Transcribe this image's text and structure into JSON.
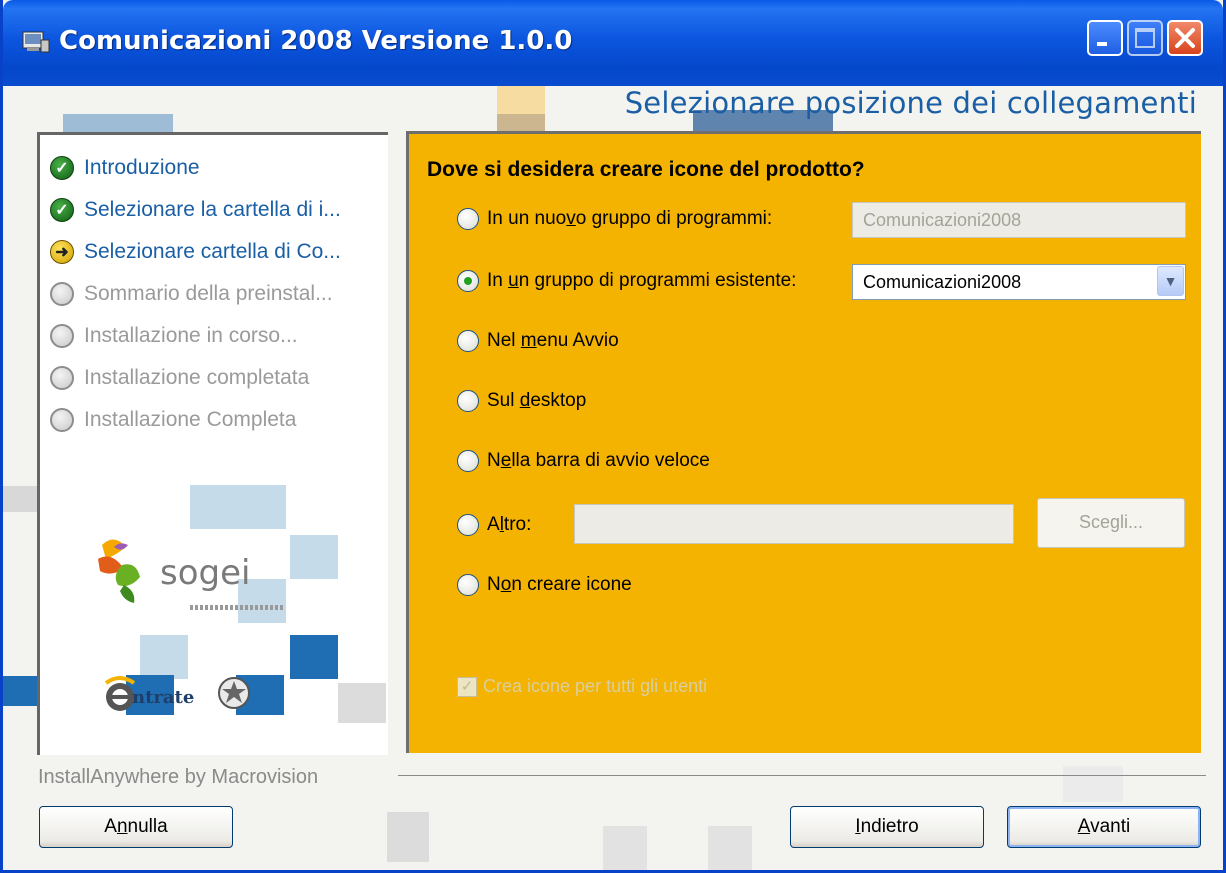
{
  "window": {
    "title": "Comunicazioni 2008 Versione 1.0.0"
  },
  "heading": "Selezionare posizione dei collegamenti",
  "steps": [
    {
      "label": "Introduzione",
      "status": "done"
    },
    {
      "label": "Selezionare la cartella di i...",
      "status": "done"
    },
    {
      "label": "Selezionare cartella di Co...",
      "status": "current"
    },
    {
      "label": "Sommario della preinstal...",
      "status": "pending"
    },
    {
      "label": "Installazione in corso...",
      "status": "pending"
    },
    {
      "label": "Installazione completata",
      "status": "pending"
    },
    {
      "label": "Installazione Completa",
      "status": "pending"
    }
  ],
  "logos": {
    "sogei": "sogei",
    "entrate": "ntrate"
  },
  "panel": {
    "question": "Dove si desidera creare icone del prodotto?",
    "options": {
      "new_group": {
        "pre": "In un nuo",
        "u": "v",
        "post": "o gruppo di programmi:",
        "selected": false
      },
      "existing_group": {
        "pre": "In ",
        "u": "u",
        "post": "n gruppo di programmi esistente:",
        "selected": true
      },
      "start_menu": {
        "pre": "Nel ",
        "u": "m",
        "post": "enu Avvio",
        "selected": false
      },
      "desktop": {
        "pre": "Sul ",
        "u": "d",
        "post": "esktop",
        "selected": false
      },
      "quick_launch": {
        "pre": "N",
        "u": "e",
        "post": "lla barra di avvio veloce",
        "selected": false
      },
      "other": {
        "pre": "A",
        "u": "l",
        "post": "tro:",
        "selected": false
      },
      "none": {
        "pre": "N",
        "u": "o",
        "post": "n creare icone",
        "selected": false
      }
    },
    "new_group_value": "Comunicazioni2008",
    "existing_group_value": "Comunicazioni2008",
    "other_value": "",
    "choose_button": "Scegli...",
    "all_users_checkbox": {
      "label": "Crea icone per tutti gli utenti",
      "checked": true,
      "enabled": false
    }
  },
  "footer": {
    "vendor": "InstallAnywhere by Macrovision",
    "cancel": {
      "pre": "A",
      "u": "n",
      "post": "nulla"
    },
    "back": {
      "pre": "",
      "u": "I",
      "post": "ndietro"
    },
    "next": {
      "pre": "",
      "u": "A",
      "post": "vanti"
    }
  },
  "colors": {
    "panel_bg": "#F5B301",
    "heading": "#1A5FA5",
    "titlebar": "#0A4CCF"
  }
}
